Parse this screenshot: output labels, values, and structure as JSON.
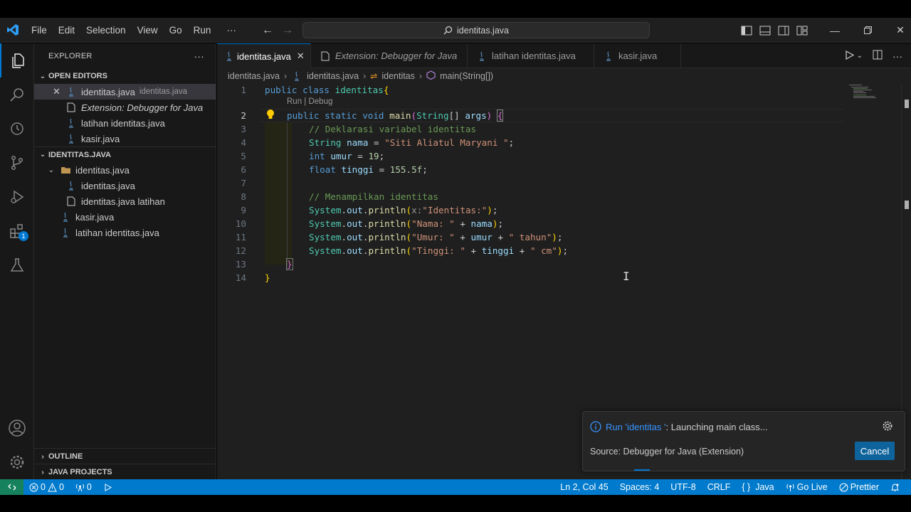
{
  "titlebar": {
    "menu": [
      "File",
      "Edit",
      "Selection",
      "View",
      "Go",
      "Run",
      "···"
    ],
    "search_text": "identitas.java"
  },
  "activity": {
    "extensions_badge": "1"
  },
  "sidebar": {
    "title": "EXPLORER",
    "more": "···",
    "open_editors_title": "OPEN EDITORS",
    "open_editors": [
      {
        "name": "identitas.java",
        "desc": "identitas.java"
      },
      {
        "name": "Extension: Debugger for Java"
      },
      {
        "name": "latihan identitas.java"
      },
      {
        "name": "kasir.java"
      }
    ],
    "project_title": "IDENTITAS.JAVA",
    "tree": [
      {
        "name": "identitas.java"
      },
      {
        "name": "identitas.java"
      },
      {
        "name": "identitas.java latihan"
      },
      {
        "name": "kasir.java"
      },
      {
        "name": "latihan identitas.java"
      }
    ],
    "outline_title": "OUTLINE",
    "java_projects_title": "JAVA PROJECTS"
  },
  "tabs": [
    {
      "label": "identitas.java",
      "close": "✕"
    },
    {
      "label": "Extension: Debugger for Java"
    },
    {
      "label": "latihan identitas.java"
    },
    {
      "label": "kasir.java"
    }
  ],
  "breadcrumb": {
    "items": [
      "identitas.java",
      "identitas.java",
      "identitas",
      "main(String[])"
    ],
    "sep": "›"
  },
  "code": {
    "codelens": "Run | Debug",
    "line_numbers": [
      "1",
      "2",
      "3",
      "4",
      "5",
      "6",
      "7",
      "8",
      "9",
      "10",
      "11",
      "12",
      "13",
      "14"
    ],
    "l1": {
      "kw1": "public",
      "kw2": "class",
      "name": "identitas",
      "brace": "{"
    },
    "l2": {
      "kw1": "public",
      "kw2": "static",
      "kw3": "void",
      "fn": "main",
      "p1": "(",
      "ty": "String",
      "arr": "[]",
      "arg": "args",
      "p2": ")",
      "brace": "{"
    },
    "l3": "// Deklarasi variabel identitas",
    "l4": {
      "ty": "String",
      "var": "nama",
      "eq": " = ",
      "str": "\"Siti Aliatul Maryani \"",
      "semi": ";"
    },
    "l5": {
      "ty": "int",
      "var": "umur",
      "eq": " = ",
      "num": "19",
      "semi": ";"
    },
    "l6": {
      "ty": "float",
      "var": "tinggi",
      "eq": " = ",
      "num": "155.5f",
      "semi": ";"
    },
    "l8": "// Menampilkan identitas",
    "l9": {
      "obj": "System",
      "dot1": ".",
      "out": "out",
      "dot2": ".",
      "fn": "println",
      "p1": "(",
      "hint": "x:",
      "str": "\"Identitas:\"",
      "p2": ")",
      "semi": ";"
    },
    "l10": {
      "obj": "System",
      "dot1": ".",
      "out": "out",
      "dot2": ".",
      "fn": "println",
      "p1": "(",
      "str": "\"Nama: \"",
      "plus": " + ",
      "var": "nama",
      "p2": ")",
      "semi": ";"
    },
    "l11": {
      "obj": "System",
      "dot1": ".",
      "out": "out",
      "dot2": ".",
      "fn": "println",
      "p1": "(",
      "str": "\"Umur: \"",
      "plus": " + ",
      "var": "umur",
      "plus2": " + ",
      "str2": "\" tahun\"",
      "p2": ")",
      "semi": ";"
    },
    "l12": {
      "obj": "System",
      "dot1": ".",
      "out": "out",
      "dot2": ".",
      "fn": "println",
      "p1": "(",
      "str": "\"Tinggi: \"",
      "plus": " + ",
      "var": "tinggi",
      "plus2": " + ",
      "str2": "\" cm\"",
      "p2": ")",
      "semi": ";"
    },
    "l13": "}",
    "l14": "}"
  },
  "notification": {
    "link": "Run 'identitas '",
    "message": ": Launching main class...",
    "source": "Source: Debugger for Java (Extension)",
    "cancel": "Cancel"
  },
  "statusbar": {
    "errors": "0",
    "warnings": "0",
    "ports": "0",
    "position": "Ln 2, Col 45",
    "spaces": "Spaces: 4",
    "encoding": "UTF-8",
    "eol": "CRLF",
    "lang_braces": "{ }",
    "language": "Java",
    "golive": "Go Live",
    "prettier": "Prettier"
  },
  "colors": {
    "accent": "#0078d4",
    "statusbar": "#007acc",
    "remote": "#16825d"
  }
}
